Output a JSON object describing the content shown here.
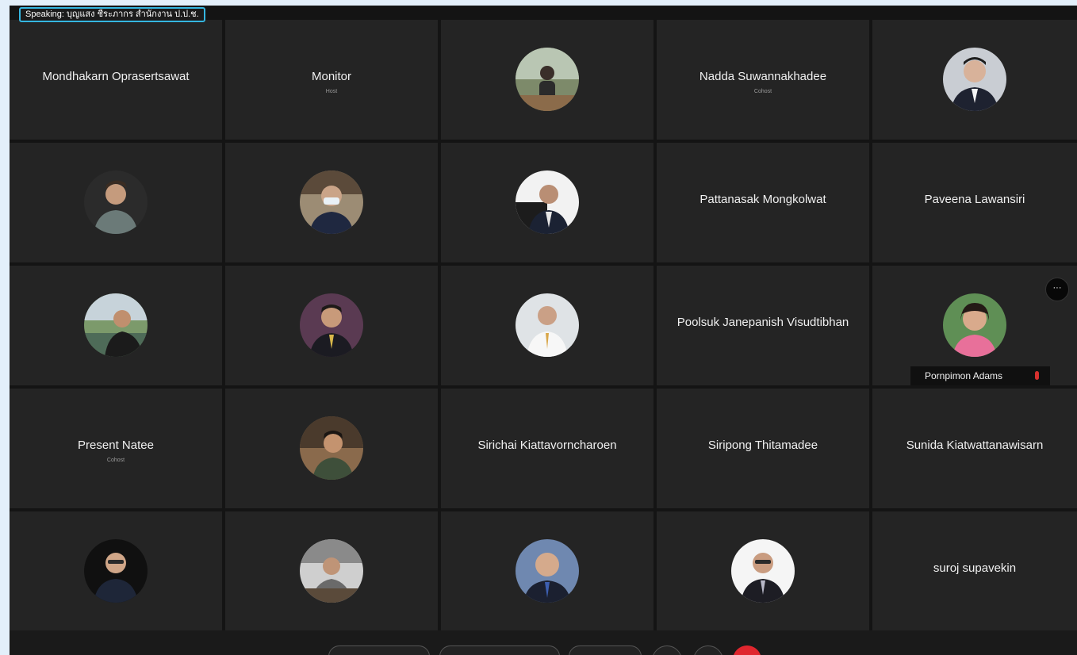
{
  "speaking": {
    "label": "Speaking: บุญแสง ชีระภากร สำนักงาน ป.ป.ช."
  },
  "participants": [
    {
      "name": "Mondhakarn Oprasertsawat",
      "role": ""
    },
    {
      "name": "Monitor",
      "role": "Host"
    },
    {
      "name": "",
      "role": ""
    },
    {
      "name": "Nadda Suwannakhadee",
      "role": "Cohost"
    },
    {
      "name": "",
      "role": ""
    },
    {
      "name": "",
      "role": ""
    },
    {
      "name": "",
      "role": ""
    },
    {
      "name": "",
      "role": ""
    },
    {
      "name": "Pattanasak Mongkolwat",
      "role": ""
    },
    {
      "name": "Paveena Lawansiri",
      "role": ""
    },
    {
      "name": "",
      "role": ""
    },
    {
      "name": "",
      "role": ""
    },
    {
      "name": "",
      "role": ""
    },
    {
      "name": "Poolsuk Janepanish Visudtibhan",
      "role": ""
    },
    {
      "name": "",
      "role": "",
      "tag": "Pornpimon Adams",
      "more": "···"
    },
    {
      "name": "Present Natee",
      "role": "Cohost"
    },
    {
      "name": "",
      "role": ""
    },
    {
      "name": "Sirichai Kiattavorncharoen",
      "role": ""
    },
    {
      "name": "Siripong Thitamadee",
      "role": ""
    },
    {
      "name": "Sunida Kiatwattanawisarn",
      "role": ""
    },
    {
      "name": "",
      "role": ""
    },
    {
      "name": "",
      "role": ""
    },
    {
      "name": "",
      "role": ""
    },
    {
      "name": "",
      "role": ""
    },
    {
      "name": "suroj supavekin",
      "role": ""
    }
  ],
  "colors": {
    "speaking_border": "#35b6e0",
    "tile": "#242424",
    "end_call": "#e0262e"
  }
}
